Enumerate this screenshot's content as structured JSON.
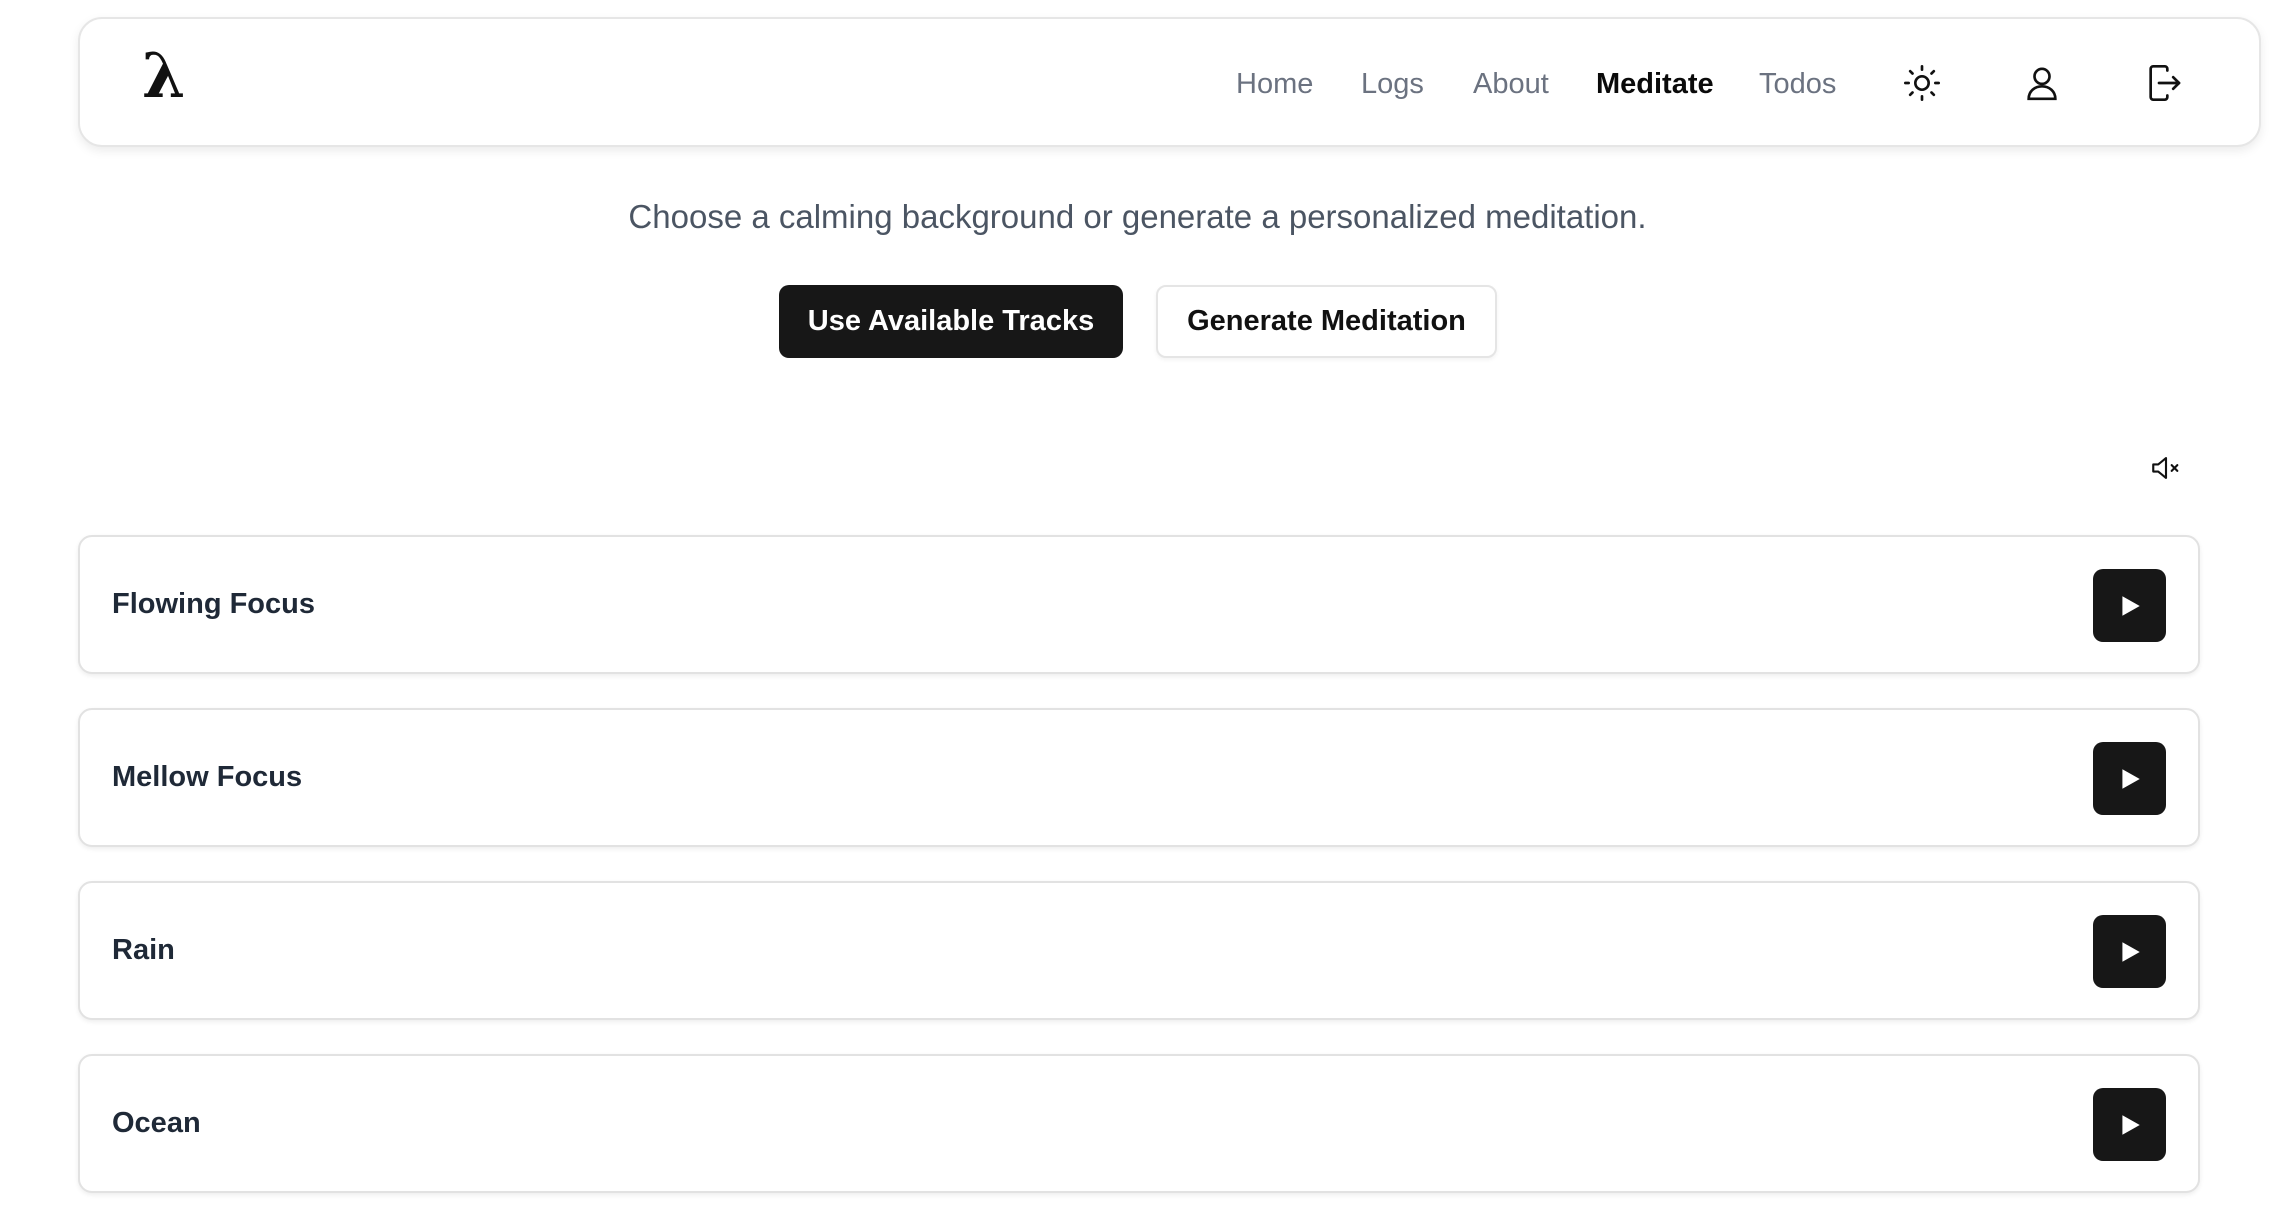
{
  "header": {
    "logo": "λ",
    "nav": [
      {
        "label": "Home",
        "active": false
      },
      {
        "label": "Logs",
        "active": false
      },
      {
        "label": "About",
        "active": false
      },
      {
        "label": "Meditate",
        "active": true
      },
      {
        "label": "Todos",
        "active": false
      }
    ],
    "icons": [
      "sun-icon",
      "user-icon",
      "logout-icon"
    ]
  },
  "main": {
    "subtitle": "Choose a calming background or generate a personalized meditation.",
    "primary_button": "Use Available Tracks",
    "secondary_button": "Generate Meditation",
    "mute_icon": "volume-mute-icon"
  },
  "tracks": [
    {
      "name": "Flowing Focus",
      "icon": "play-icon"
    },
    {
      "name": "Mellow Focus",
      "icon": "play-icon"
    },
    {
      "name": "Rain",
      "icon": "play-icon"
    },
    {
      "name": "Ocean",
      "icon": "play-icon"
    }
  ],
  "colors": {
    "primary": "#171717",
    "nav_inactive": "#6b7280",
    "subtitle": "#4b5563",
    "border": "#e2e2e2"
  }
}
